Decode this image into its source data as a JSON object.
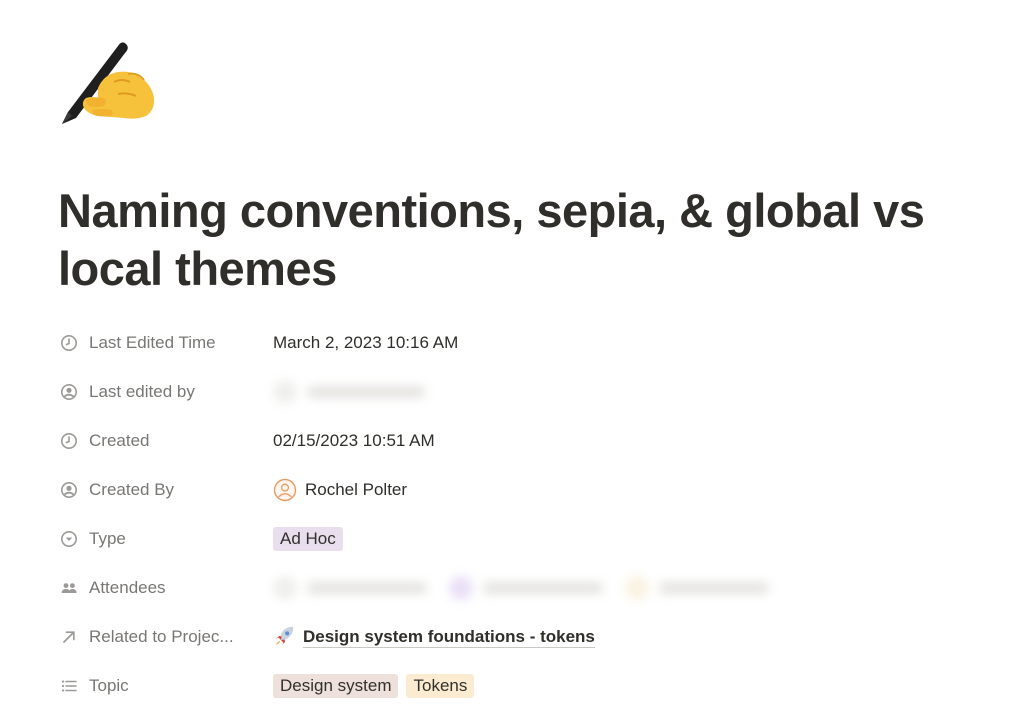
{
  "page": {
    "icon": "writing-hand-icon",
    "title": "Naming conventions, sepia, & global vs local themes"
  },
  "properties": {
    "last_edited_time": {
      "label": "Last Edited Time",
      "icon": "clock-icon",
      "value": "March 2, 2023 10:16 AM"
    },
    "last_edited_by": {
      "label": "Last edited by",
      "icon": "person-circle-icon"
    },
    "created": {
      "label": "Created",
      "icon": "clock-icon",
      "value": "02/15/2023 10:51 AM"
    },
    "created_by": {
      "label": "Created By",
      "icon": "person-circle-icon",
      "value": "Rochel Polter"
    },
    "type": {
      "label": "Type",
      "icon": "chevron-circle-icon",
      "value": "Ad Hoc",
      "color": "#e8deee"
    },
    "attendees": {
      "label": "Attendees",
      "icon": "people-icon"
    },
    "related_project": {
      "label": "Related to Projec...",
      "icon": "arrow-up-right-icon",
      "value_icon": "rocket-icon",
      "value": "Design system foundations - tokens"
    },
    "topic": {
      "label": "Topic",
      "icon": "list-icon",
      "tags": [
        {
          "label": "Design system",
          "color": "#eee0da"
        },
        {
          "label": "Tokens",
          "color": "#fbecd1"
        }
      ]
    }
  }
}
